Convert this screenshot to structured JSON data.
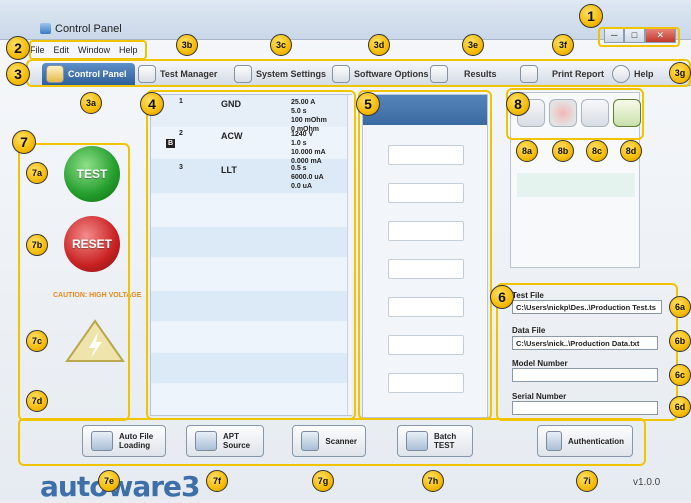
{
  "window": {
    "title": "Control Panel",
    "controls": [
      "─",
      "□",
      "✕"
    ]
  },
  "menu": [
    "File",
    "Edit",
    "Window",
    "Help"
  ],
  "tabs": [
    "Control Panel",
    "Test Manager",
    "System Settings",
    "Software Options",
    "Results",
    "Print Report",
    "Help"
  ],
  "steps": [
    {
      "num": "1",
      "name": "GND",
      "values": "25.00 A\n5.0 s\n100 mOhm\n0 mOhm",
      "badge": ""
    },
    {
      "num": "2",
      "name": "ACW",
      "values": "1240 V\n1.0 s\n10.000 mA\n0.000 mA",
      "badge": "B"
    },
    {
      "num": "3",
      "name": "LLT",
      "values": "0.5 s\n6000.0 uA\n0.0 uA",
      "badge": ""
    }
  ],
  "buttons": {
    "test": "TEST",
    "reset": "RESET"
  },
  "caution": "CAUTION: HIGH VOLTAGE",
  "fields": {
    "test_file_label": "Test File",
    "test_file_value": "C:\\Users\\nickp\\Des..\\Production Test.ts",
    "data_file_label": "Data File",
    "data_file_value": "C:\\Users\\nick..\\Production Data.txt",
    "model_label": "Model Number",
    "model_value": "",
    "serial_label": "Serial Number",
    "serial_value": ""
  },
  "toolbar": [
    {
      "line1": "Auto File",
      "line2": "Loading"
    },
    {
      "line1": "APT",
      "line2": "Source"
    },
    {
      "line1": "Scanner",
      "line2": ""
    },
    {
      "line1": "Batch",
      "line2": "TEST"
    },
    {
      "line1": "Authentication",
      "line2": ""
    }
  ],
  "logo": "autoware3",
  "version": "v1.0.0",
  "callouts": [
    "1",
    "2",
    "3",
    "3a",
    "3b",
    "3c",
    "3d",
    "3e",
    "3f",
    "3g",
    "4",
    "5",
    "6",
    "6a",
    "6b",
    "6c",
    "6d",
    "7",
    "7a",
    "7b",
    "7c",
    "7d",
    "7e",
    "7f",
    "7g",
    "7h",
    "7i",
    "8",
    "8a",
    "8b",
    "8c",
    "8d"
  ]
}
